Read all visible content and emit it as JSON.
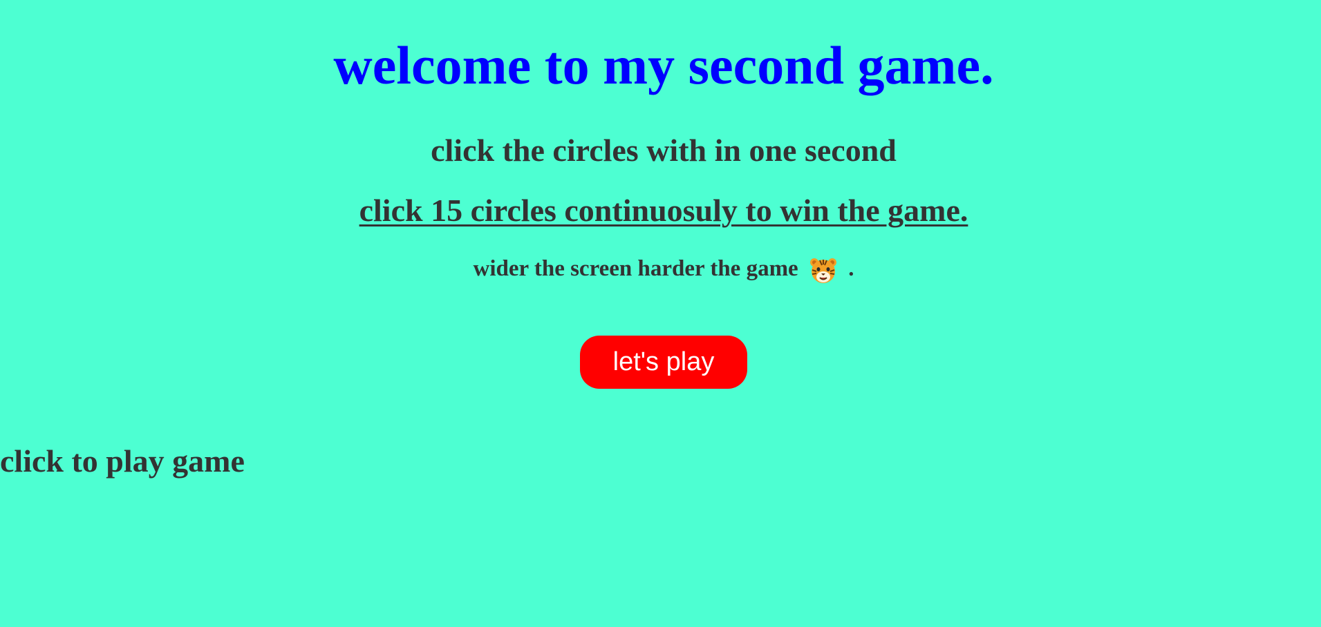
{
  "page": {
    "title": "welcome to my second game.",
    "instruction_1": "click the circles with in one second",
    "instruction_2": "click 15 circles continuosuly to win the game.",
    "instruction_3_prefix": "wider the screen harder the game",
    "instruction_3_icon": "tiger-face-icon",
    "instruction_3_suffix": ".",
    "play_button_label": "let's play",
    "status_text": "click to play game"
  },
  "colors": {
    "background": "#4dffd2",
    "title": "#0000ff",
    "text": "#333333",
    "button_bg": "#ff0000",
    "button_text": "#ffffff"
  }
}
